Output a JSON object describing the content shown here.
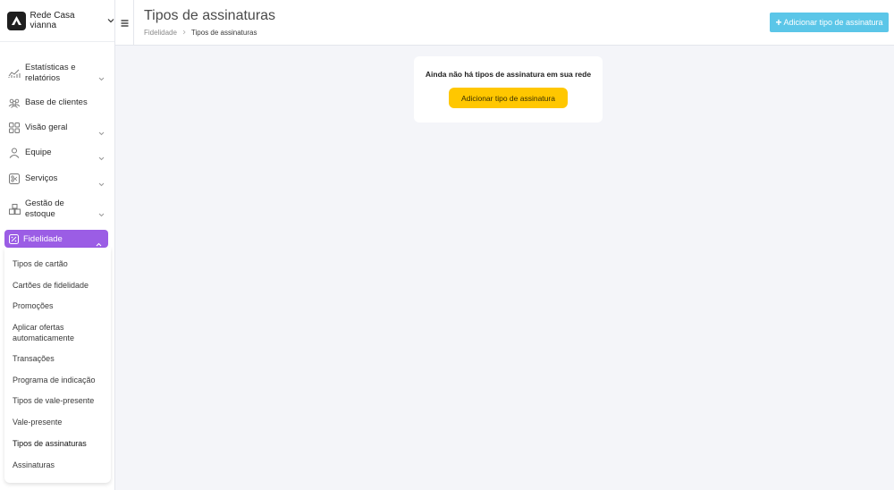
{
  "brand": {
    "name": "Rede Casa vianna",
    "logo_icon": "brand-logo-icon"
  },
  "sidebar": {
    "items": [
      {
        "label": "Estatísticas e relatórios",
        "icon": "chart-icon",
        "has_chevron": true
      },
      {
        "label": "Base de clientes",
        "icon": "users-icon",
        "has_chevron": false
      },
      {
        "label": "Visão geral",
        "icon": "grid-icon",
        "has_chevron": true
      },
      {
        "label": "Equipe",
        "icon": "user-icon",
        "has_chevron": true
      },
      {
        "label": "Serviços",
        "icon": "scissors-icon",
        "has_chevron": true
      },
      {
        "label": "Gestão de estoque",
        "icon": "boxes-icon",
        "has_chevron": true
      }
    ],
    "active": {
      "label": "Fidelidade",
      "icon": "percent-icon",
      "color": "#9b5de5"
    },
    "submenu": [
      "Tipos de cartão",
      "Cartões de fidelidade",
      "Promoções",
      "Aplicar ofertas automaticamente",
      "Transações",
      "Programa de indicação",
      "Tipos de vale-presente",
      "Vale-presente",
      "Tipos de assinaturas",
      "Assinaturas"
    ],
    "submenu_active": "Tipos de assinaturas"
  },
  "header": {
    "title": "Tipos de assinaturas",
    "breadcrumb": [
      "Fidelidade",
      "Tipos de assinaturas"
    ],
    "add_button": "Adicionar tipo de assinatura",
    "add_button_color": "#5bc6e8"
  },
  "empty_state": {
    "message": "Ainda não há tipos de assinatura em sua rede",
    "button": "Adicionar tipo de assinatura",
    "button_color": "#ffc700"
  }
}
